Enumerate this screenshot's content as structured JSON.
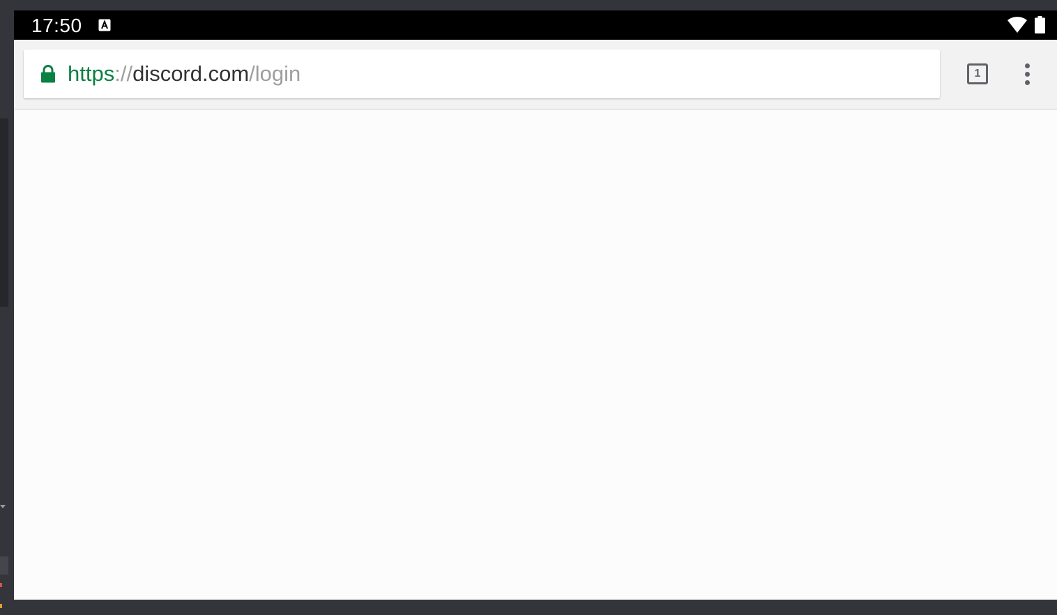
{
  "status_bar": {
    "time": "17:50",
    "notification_icon": "a-notification-icon",
    "wifi_icon": "wifi-icon",
    "battery_icon": "battery-icon"
  },
  "browser": {
    "lock_icon": "lock-icon",
    "url": {
      "scheme": "https",
      "separator": "://",
      "host": "discord.com",
      "path": "/login"
    },
    "tab_count": "1",
    "menu_icon": "more-vert-icon"
  },
  "colors": {
    "secure_green": "#0b8043",
    "status_bar_bg": "#000000",
    "toolbar_bg": "#f2f2f2"
  }
}
